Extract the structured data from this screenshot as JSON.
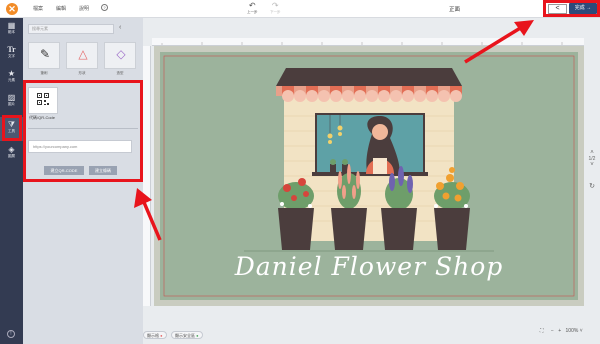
{
  "topbar": {
    "menu_file": "檔案",
    "menu_edit": "編輯",
    "menu_help": "說明",
    "help_icon": "?",
    "undo_label": "上一步",
    "redo_label": "下一步",
    "doc_title": "正面",
    "share_icon": "share-icon",
    "done_label": "完成 →"
  },
  "sidebar": {
    "items": [
      {
        "icon": "template-icon",
        "label": "範本"
      },
      {
        "icon": "text-icon",
        "label": "文字"
      },
      {
        "icon": "star-icon",
        "label": "元素"
      },
      {
        "icon": "image-icon",
        "label": "圖片"
      },
      {
        "icon": "tools-icon",
        "label": "工具"
      },
      {
        "icon": "layers-icon",
        "label": "圖層"
      }
    ],
    "active_index": 4
  },
  "panel": {
    "search_placeholder": "搜尋元素",
    "categories": [
      {
        "icon": "pen-icon",
        "label": "筆刷"
      },
      {
        "icon": "shape-icon",
        "label": "形狀"
      },
      {
        "icon": "diamond-icon",
        "label": "造型"
      }
    ],
    "qr_label": "代碼/QR-Code",
    "url_placeholder": "https://yourcompany.com",
    "create_qr_label": "建立QR-CODE",
    "create_barcode_label": "建立條碼"
  },
  "canvas": {
    "shop_name": "Daniel Flower Shop"
  },
  "pager": {
    "page": "1/2"
  },
  "zoom": {
    "value": "100%"
  },
  "bottom": {
    "left_label": "顯示格",
    "right_label": "顯示安全區"
  },
  "colors": {
    "accent_red": "#e8141c",
    "done_button": "#2d4a7a",
    "sidebar_bg": "#333b52",
    "card_bg": "#9cb39c",
    "logo": "#f28c28"
  }
}
